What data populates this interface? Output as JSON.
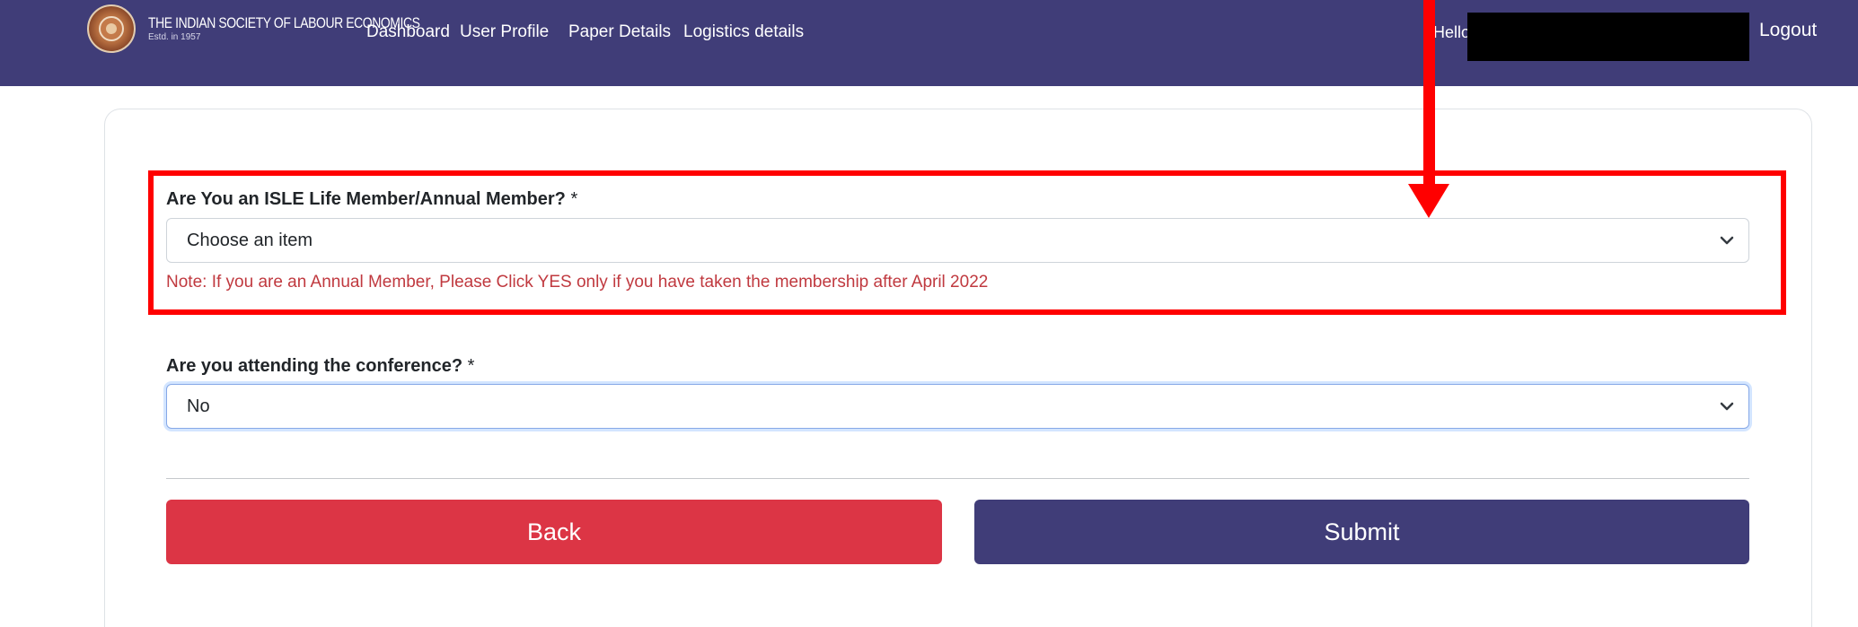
{
  "header": {
    "org_name": "THE INDIAN SOCIETY OF LABOUR ECONOMICS",
    "org_est": "Estd. in 1957",
    "nav": [
      "Dashboard",
      "User Profile",
      "Paper Details",
      "Logistics details"
    ],
    "greeting": "Hello",
    "logout": "Logout"
  },
  "form": {
    "membership": {
      "label": "Are You an ISLE Life Member/Annual Member?",
      "required_mark": "*",
      "value": "Choose an item",
      "note": "Note: If you are an Annual Member, Please Click YES only if you have taken the membership after April 2022"
    },
    "attending": {
      "label": "Are you attending the conference?",
      "required_mark": "*",
      "value": "No"
    },
    "back_label": "Back",
    "submit_label": "Submit"
  },
  "colors": {
    "navbar": "#403d78",
    "back_button": "#dc3545",
    "submit_button": "#403d78",
    "note_text": "#c0393f",
    "annotation": "#ff0000"
  },
  "icons": [
    "society-logo-icon",
    "chevron-down-icon"
  ]
}
